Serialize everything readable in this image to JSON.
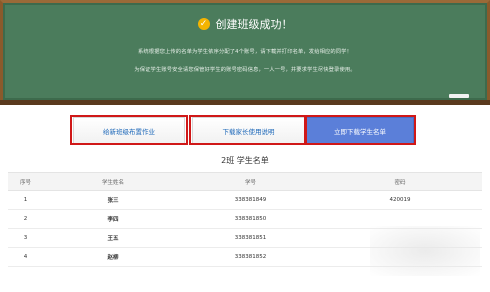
{
  "board": {
    "title": "创建班级成功！",
    "line1": "系统根据您上传的名单为学生依序分配了4个账号，请下载并打印名单，发给相应的同学！",
    "line2": "为保证学生账号安全请您保管好学生的账号密码信息，一人一号，并要求学生尽快登录使用。"
  },
  "buttons": {
    "assign_homework": "给新班级布置作业",
    "parent_guide": "下载家长使用说明",
    "download_list": "立即下载学生名单"
  },
  "table": {
    "title": "2班 学生名单",
    "headers": [
      "序号",
      "学生姓名",
      "学号",
      "密码"
    ],
    "rows": [
      [
        "1",
        "张三",
        "338381849",
        "420019"
      ],
      [
        "2",
        "李四",
        "338381850",
        ""
      ],
      [
        "3",
        "王五",
        "338381851",
        ""
      ],
      [
        "4",
        "赵柳",
        "338381852",
        ""
      ]
    ]
  },
  "colors": {
    "board": "#4b7c5c",
    "frame": "#8a5a2b",
    "primary_button": "#5b7fd9",
    "highlight": "#d01818"
  }
}
